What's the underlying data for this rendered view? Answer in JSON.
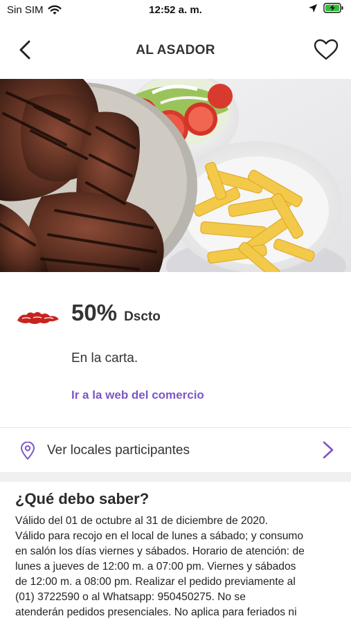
{
  "status_bar": {
    "carrier": "Sin SIM",
    "time": "12:52 a. m.",
    "icons": [
      "wifi-icon",
      "location-arrow-icon",
      "battery-charging-icon"
    ]
  },
  "nav": {
    "title": "AL ASADOR",
    "back_icon": "chevron-left-icon",
    "favorite_icon": "heart-outline-icon"
  },
  "hero": {
    "image": "grilled-steaks-salad-fries-photo"
  },
  "offer": {
    "brand_logo": "al-asador-logo",
    "discount_value": "50%",
    "discount_label": "Dscto",
    "description": "En la carta.",
    "web_link": "Ir a la web del comercio",
    "accent_color": "#7d55c7"
  },
  "locales": {
    "label": "Ver locales participantes",
    "icon": "map-pin-icon"
  },
  "info": {
    "title": "¿Qué debo saber?",
    "lines": [
      "Válido del 01 de octubre al 31 de diciembre de 2020.",
      "Válido para recojo en el local de lunes a sábado; y consumo",
      "en salón los días viernes y sábados. Horario de atención: de",
      "lunes a jueves de 12:00 m. a 07:00 pm. Viernes y sábados",
      "de 12:00 m. a 08:00 pm. Realizar el pedido previamente al",
      "(01) 3722590 o al Whatsapp: 950450275. No se",
      "atenderán pedidos presenciales. No aplica para feriados ni"
    ]
  }
}
